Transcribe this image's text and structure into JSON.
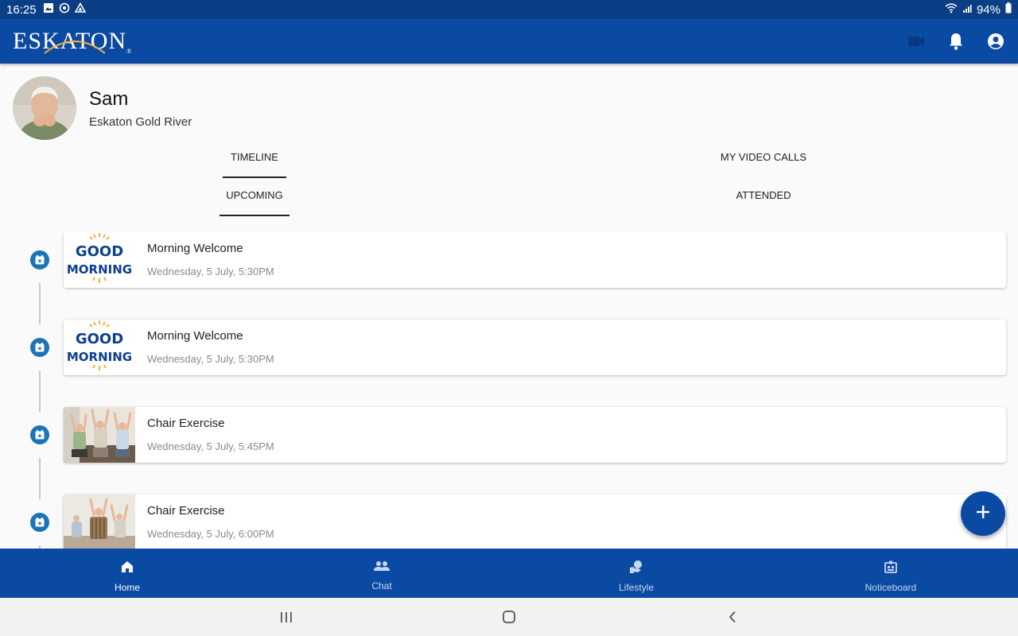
{
  "status_bar": {
    "time": "16:25",
    "battery": "94%",
    "left_icons": [
      "image-icon",
      "sync-icon",
      "drive-icon"
    ],
    "right_icons": [
      "wifi-icon",
      "signal-icon"
    ]
  },
  "app_bar": {
    "logo_text": "ESKATON",
    "logo_mark": "®",
    "actions": [
      "video-call-icon",
      "notifications-icon",
      "account-icon"
    ]
  },
  "profile": {
    "name": "Sam",
    "community": "Eskaton Gold River"
  },
  "tabs_primary": {
    "items": [
      "TIMELINE",
      "MY VIDEO CALLS"
    ],
    "selected": "TIMELINE"
  },
  "tabs_secondary": {
    "items": [
      "UPCOMING",
      "ATTENDED"
    ],
    "selected": "UPCOMING"
  },
  "timeline": {
    "items": [
      {
        "title": "Morning Welcome",
        "datetime": "Wednesday, 5 July, 5:30PM",
        "thumb": "good-morning"
      },
      {
        "title": "Morning Welcome",
        "datetime": "Wednesday, 5 July, 5:30PM",
        "thumb": "good-morning"
      },
      {
        "title": "Chair Exercise",
        "datetime": "Wednesday, 5 July, 5:45PM",
        "thumb": "chair-exercise"
      },
      {
        "title": "Chair Exercise",
        "datetime": "Wednesday, 5 July, 6:00PM",
        "thumb": "chair-exercise"
      }
    ],
    "thumb_text": {
      "line1": "GOOD",
      "line2": "MORNING"
    }
  },
  "fab": {
    "icon": "add-icon"
  },
  "bottom_nav": {
    "items": [
      {
        "label": "Home",
        "icon": "home-icon"
      },
      {
        "label": "Chat",
        "icon": "people-icon"
      },
      {
        "label": "Lifestyle",
        "icon": "lifestyle-icon"
      },
      {
        "label": "Noticeboard",
        "icon": "noticeboard-icon"
      }
    ],
    "selected": "Home"
  },
  "system_nav": [
    "recents-icon",
    "home-circle-icon",
    "back-icon"
  ],
  "colors": {
    "primary": "#0b4aa2",
    "status_bar": "#0a3f86",
    "timeline_dot": "#1b73b8",
    "background": "#fafafa"
  }
}
